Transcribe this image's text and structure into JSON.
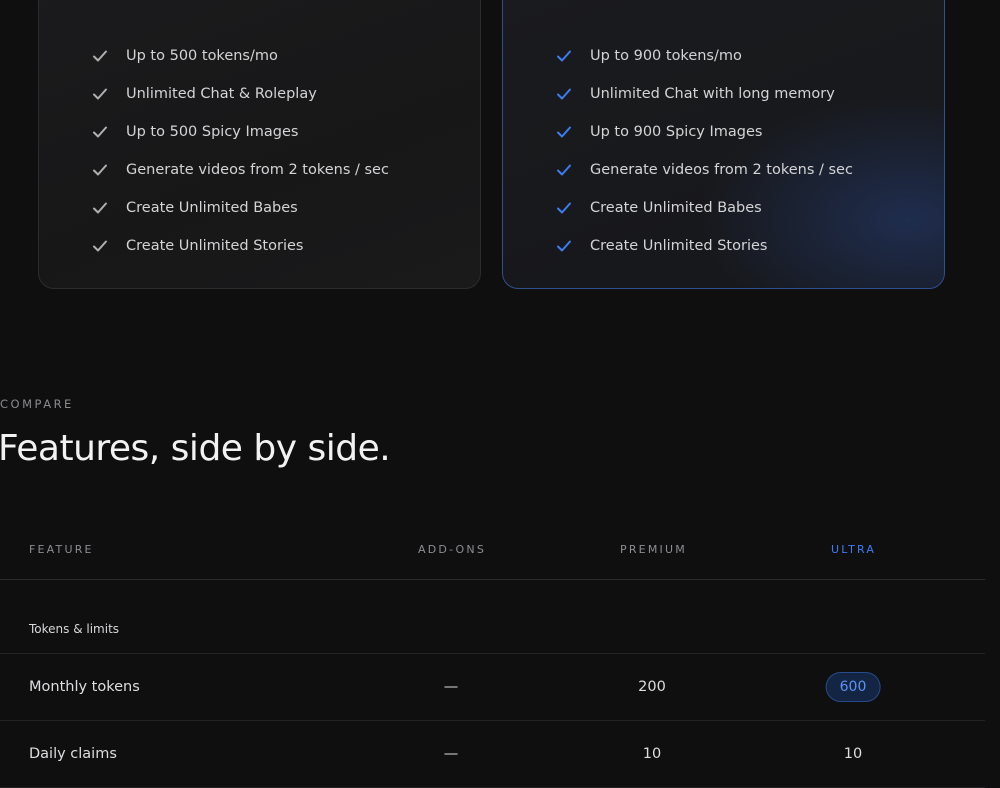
{
  "plans": {
    "premium": {
      "features": [
        "Up to 500 tokens/mo",
        "Unlimited Chat & Roleplay",
        "Up to 500 Spicy Images",
        "Generate videos from 2 tokens / sec",
        "Create Unlimited Babes",
        "Create Unlimited Stories"
      ]
    },
    "ultra": {
      "features": [
        "Up to 900 tokens/mo",
        "Unlimited Chat with long memory",
        "Up to 900 Spicy Images",
        "Generate videos from 2 tokens / sec",
        "Create Unlimited Babes",
        "Create Unlimited Stories"
      ]
    }
  },
  "compare": {
    "eyebrow": "COMPARE",
    "heading": "Features, side by side.",
    "columns": [
      "FEATURE",
      "ADD-ONS",
      "PREMIUM",
      "ULTRA"
    ],
    "groups": [
      {
        "label": "Tokens & limits",
        "rows": [
          {
            "name": "Monthly tokens",
            "addons": "—",
            "premium": "200",
            "ultra": "600",
            "ultra_highlight": true
          },
          {
            "name": "Daily claims",
            "addons": "—",
            "premium": "10",
            "ultra": "10",
            "ultra_highlight": false
          }
        ]
      }
    ]
  },
  "colors": {
    "accent": "#3d7cf2",
    "background": "#0f0f10"
  },
  "icons": {
    "feature_check": "check-icon"
  }
}
